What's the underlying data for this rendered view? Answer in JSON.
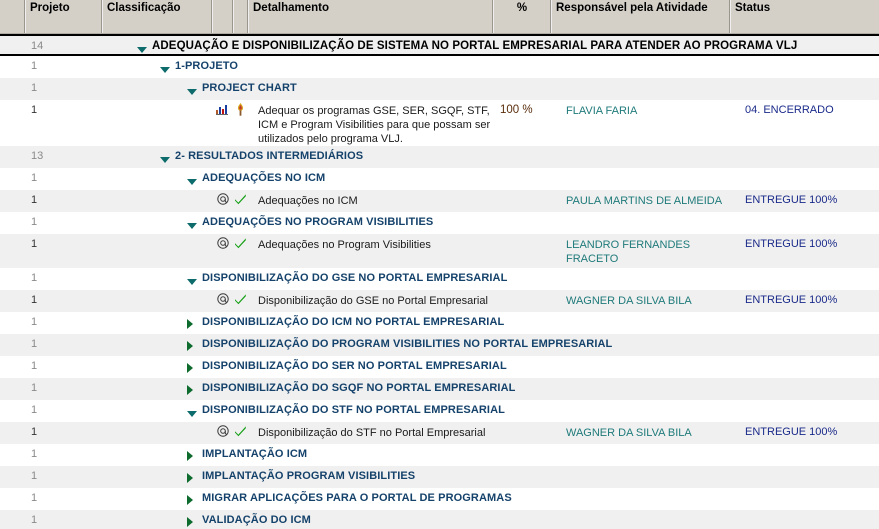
{
  "header": {
    "columns": [
      {
        "key": "gutter",
        "label": ""
      },
      {
        "key": "projeto",
        "label": "Projeto"
      },
      {
        "key": "classificacao",
        "label": "Classificação"
      },
      {
        "key": "icon1",
        "label": ""
      },
      {
        "key": "icon2",
        "label": ""
      },
      {
        "key": "detalhamento",
        "label": "Detalhamento"
      },
      {
        "key": "percent",
        "label": "%"
      },
      {
        "key": "responsavel",
        "label": "Responsável pela Atividade"
      },
      {
        "key": "status",
        "label": "Status"
      }
    ]
  },
  "colors": {
    "header_bg": "#d4d0c8",
    "group_label": "#15426b",
    "responsavel": "#1f7a7a",
    "status": "#1a2a8a",
    "percent": "#5a2d0c",
    "row_alt": "#f0f0f0",
    "triangle_open": "#0d6b6b",
    "triangle_closed": "#0d6b2e",
    "check": "#17a017"
  },
  "rows": [
    {
      "type": "root",
      "projeto": "14",
      "indent": 0,
      "toggle": "expanded",
      "toggle_icon": "chevron-down-icon",
      "classificacao": "ADEQUAÇÃO E DISPONIBILIZAÇÃO DE SISTEMA NO PORTAL EMPRESARIAL PARA ATENDER AO PROGRAMA VLJ",
      "detalhamento": "",
      "percent": "",
      "responsavel": "",
      "status": "",
      "shade": "alt"
    },
    {
      "type": "group",
      "projeto": "1",
      "indent": 1,
      "toggle": "expanded",
      "toggle_icon": "chevron-down-icon",
      "classificacao": "1-PROJETO",
      "detalhamento": "",
      "percent": "",
      "responsavel": "",
      "status": "",
      "shade": "white"
    },
    {
      "type": "group",
      "projeto": "1",
      "indent": 2,
      "toggle": "expanded",
      "toggle_icon": "chevron-down-icon",
      "classificacao": "PROJECT CHART",
      "detalhamento": "",
      "percent": "",
      "responsavel": "",
      "status": "",
      "shade": "alt"
    },
    {
      "type": "task",
      "projeto": "1",
      "indent": 0,
      "toggle": "none",
      "classificacao": "",
      "icon1": "bar-chart-icon",
      "icon2": "torch-icon",
      "detalhamento": "Adequar os programas GSE, SER, SGQF, STF, ICM e Program Visibilities para que possam ser utilizados pelo programa VLJ.",
      "percent": "100 %",
      "responsavel": "FLAVIA FARIA",
      "status": "04. ENCERRADO",
      "shade": "white",
      "tall": true
    },
    {
      "type": "group",
      "projeto": "13",
      "indent": 1,
      "toggle": "expanded",
      "toggle_icon": "chevron-down-icon",
      "classificacao": "2- RESULTADOS INTERMEDIÁRIOS",
      "detalhamento": "",
      "percent": "",
      "responsavel": "",
      "status": "",
      "shade": "alt"
    },
    {
      "type": "group",
      "projeto": "1",
      "indent": 2,
      "toggle": "expanded",
      "toggle_icon": "chevron-down-icon",
      "classificacao": "ADEQUAÇÕES NO ICM",
      "detalhamento": "",
      "percent": "",
      "responsavel": "",
      "status": "",
      "shade": "white"
    },
    {
      "type": "task",
      "projeto": "1",
      "indent": 0,
      "toggle": "none",
      "classificacao": "",
      "icon1": "at-sign-icon",
      "icon2": "check-icon",
      "detalhamento": "Adequações no ICM",
      "percent": "",
      "responsavel": "PAULA MARTINS DE ALMEIDA",
      "status": "ENTREGUE 100%",
      "shade": "alt"
    },
    {
      "type": "group",
      "projeto": "1",
      "indent": 2,
      "toggle": "expanded",
      "toggle_icon": "chevron-down-icon",
      "classificacao": "ADEQUAÇÕES NO PROGRAM VISIBILITIES",
      "detalhamento": "",
      "percent": "",
      "responsavel": "",
      "status": "",
      "shade": "white"
    },
    {
      "type": "task",
      "projeto": "1",
      "indent": 0,
      "toggle": "none",
      "classificacao": "",
      "icon1": "at-sign-icon",
      "icon2": "check-icon",
      "detalhamento": "Adequações no Program Visibilities",
      "percent": "",
      "responsavel": "LEANDRO FERNANDES FRACETO",
      "status": "ENTREGUE 100%",
      "shade": "alt",
      "tall2": true
    },
    {
      "type": "group",
      "projeto": "1",
      "indent": 2,
      "toggle": "expanded",
      "toggle_icon": "chevron-down-icon",
      "classificacao": "DISPONIBILIZAÇÃO DO GSE NO PORTAL EMPRESARIAL",
      "detalhamento": "",
      "percent": "",
      "responsavel": "",
      "status": "",
      "shade": "white"
    },
    {
      "type": "task",
      "projeto": "1",
      "indent": 0,
      "toggle": "none",
      "classificacao": "",
      "icon1": "at-sign-icon",
      "icon2": "check-icon",
      "detalhamento": "Disponibilização do GSE no Portal Empresarial",
      "percent": "",
      "responsavel": "WAGNER DA SILVA BILA",
      "status": "ENTREGUE 100%",
      "shade": "alt"
    },
    {
      "type": "group",
      "projeto": "1",
      "indent": 2,
      "toggle": "collapsed",
      "toggle_icon": "chevron-right-icon",
      "classificacao": "DISPONIBILIZAÇÃO DO ICM NO PORTAL EMPRESARIAL",
      "detalhamento": "",
      "percent": "",
      "responsavel": "",
      "status": "",
      "shade": "white"
    },
    {
      "type": "group",
      "projeto": "1",
      "indent": 2,
      "toggle": "collapsed",
      "toggle_icon": "chevron-right-icon",
      "classificacao": "DISPONIBILIZAÇÃO DO PROGRAM VISIBILITIES NO PORTAL EMPRESARIAL",
      "detalhamento": "",
      "percent": "",
      "responsavel": "",
      "status": "",
      "shade": "alt"
    },
    {
      "type": "group",
      "projeto": "1",
      "indent": 2,
      "toggle": "collapsed",
      "toggle_icon": "chevron-right-icon",
      "classificacao": "DISPONIBILIZAÇÃO DO SER NO PORTAL EMPRESARIAL",
      "detalhamento": "",
      "percent": "",
      "responsavel": "",
      "status": "",
      "shade": "white"
    },
    {
      "type": "group",
      "projeto": "1",
      "indent": 2,
      "toggle": "collapsed",
      "toggle_icon": "chevron-right-icon",
      "classificacao": "DISPONIBILIZAÇÃO DO SGQF NO PORTAL EMPRESARIAL",
      "detalhamento": "",
      "percent": "",
      "responsavel": "",
      "status": "",
      "shade": "alt"
    },
    {
      "type": "group",
      "projeto": "1",
      "indent": 2,
      "toggle": "expanded",
      "toggle_icon": "chevron-down-icon",
      "classificacao": "DISPONIBILIZAÇÃO DO STF NO PORTAL EMPRESARIAL",
      "detalhamento": "",
      "percent": "",
      "responsavel": "",
      "status": "",
      "shade": "white"
    },
    {
      "type": "task",
      "projeto": "1",
      "indent": 0,
      "toggle": "none",
      "classificacao": "",
      "icon1": "at-sign-icon",
      "icon2": "check-icon",
      "detalhamento": "Disponibilização do STF no Portal Empresarial",
      "percent": "",
      "responsavel": "WAGNER DA SILVA BILA",
      "status": "ENTREGUE 100%",
      "shade": "alt"
    },
    {
      "type": "group",
      "projeto": "1",
      "indent": 2,
      "toggle": "collapsed",
      "toggle_icon": "chevron-right-icon",
      "classificacao": "IMPLANTAÇÃO ICM",
      "detalhamento": "",
      "percent": "",
      "responsavel": "",
      "status": "",
      "shade": "white"
    },
    {
      "type": "group",
      "projeto": "1",
      "indent": 2,
      "toggle": "collapsed",
      "toggle_icon": "chevron-right-icon",
      "classificacao": "IMPLANTAÇÃO PROGRAM VISIBILITIES",
      "detalhamento": "",
      "percent": "",
      "responsavel": "",
      "status": "",
      "shade": "alt"
    },
    {
      "type": "group",
      "projeto": "1",
      "indent": 2,
      "toggle": "collapsed",
      "toggle_icon": "chevron-right-icon",
      "classificacao": "MIGRAR APLICAÇÕES PARA O PORTAL DE PROGRAMAS",
      "detalhamento": "",
      "percent": "",
      "responsavel": "",
      "status": "",
      "shade": "white"
    },
    {
      "type": "group",
      "projeto": "1",
      "indent": 2,
      "toggle": "collapsed",
      "toggle_icon": "chevron-right-icon",
      "classificacao": "VALIDAÇÃO DO ICM",
      "detalhamento": "",
      "percent": "",
      "responsavel": "",
      "status": "",
      "shade": "alt"
    }
  ]
}
